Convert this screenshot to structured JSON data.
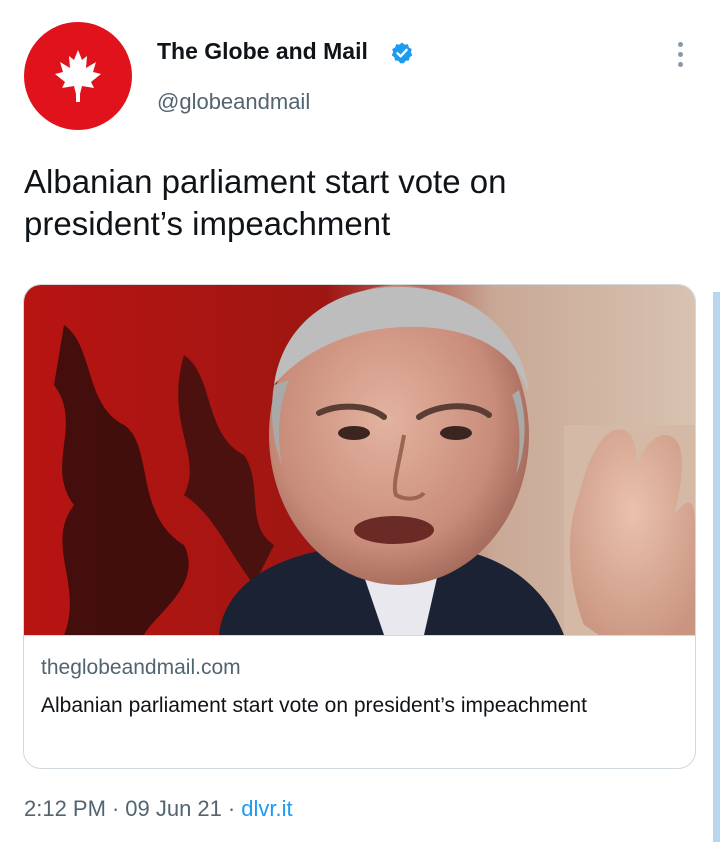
{
  "colors": {
    "brand": "#e0131d",
    "verified": "#1d9bf0",
    "link": "#1d9bf0",
    "text_secondary": "#536471",
    "scroll_accent": "#b8d6f0"
  },
  "header": {
    "avatar_icon": "maple-leaf-icon",
    "display_name": "The Globe and Mail",
    "verified_icon": "verified-badge-icon",
    "handle": "@globeandmail",
    "more_icon": "more-vertical-icon"
  },
  "tweet": {
    "text": "Albanian parliament start vote on president’s impeachment"
  },
  "card": {
    "image_description_icon": "news-photo",
    "domain": "theglobeandmail.com",
    "title": "Albanian parliament start vote on president’s impeachment"
  },
  "meta": {
    "time": "2:12 PM",
    "separator": "·",
    "date": "09 Jun 21",
    "source": "dlvr.it"
  }
}
